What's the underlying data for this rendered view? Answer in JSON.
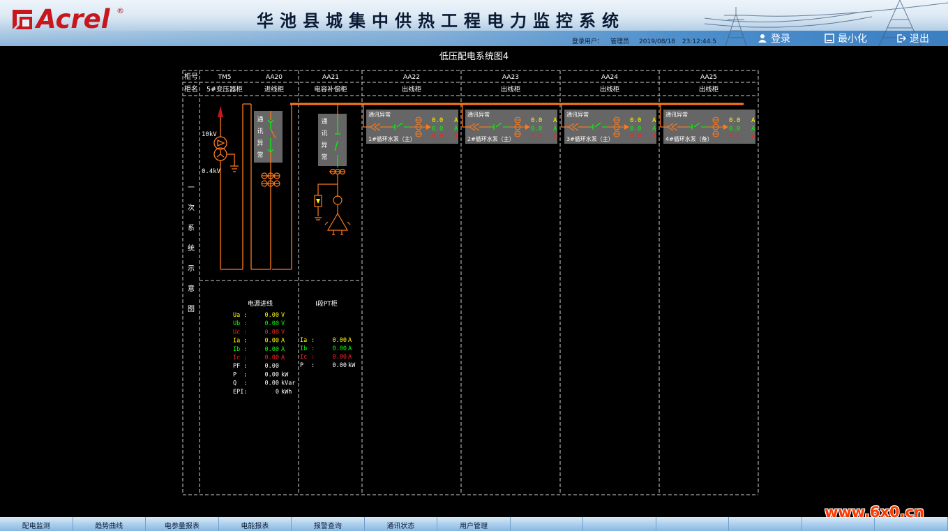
{
  "header": {
    "brand": "Acrel",
    "registered_mark": "®",
    "title": "华池县城集中供热工程电力监控系统",
    "user_label": "登录用户：",
    "user_name": "管理员",
    "date": "2019/08/18",
    "time": "23:12:44.5",
    "login": "登录",
    "minimize": "最小化",
    "exit": "退出"
  },
  "page_title": "低压配电系统图4",
  "table": {
    "row1_label": "柜号",
    "row2_label": "柜名",
    "cabinets": [
      {
        "id": "TM5",
        "name": "5#变压器柜"
      },
      {
        "id": "AA20",
        "name": "进线柜"
      },
      {
        "id": "AA21",
        "name": "电容补偿柜"
      },
      {
        "id": "AA22",
        "name": "出线柜"
      },
      {
        "id": "AA23",
        "name": "出线柜"
      },
      {
        "id": "AA24",
        "name": "出线柜"
      },
      {
        "id": "AA25",
        "name": "出线柜"
      }
    ],
    "side_label": [
      "一",
      "次",
      "系",
      "统",
      "示",
      "意",
      "图"
    ]
  },
  "transformer": {
    "hv": "10kV",
    "lv": "0.4kV"
  },
  "comm_alarm_vertical": [
    "通",
    "讯",
    "异",
    "常"
  ],
  "outgoing": [
    {
      "alarm": "通讯异常",
      "name": "1#循环水泵（主）",
      "v1": "0.0",
      "v2": "0.0",
      "v3": "0.0",
      "unit": "A"
    },
    {
      "alarm": "通讯异常",
      "name": "2#循环水泵（主）",
      "v1": "0.0",
      "v2": "0.0",
      "v3": "0.0",
      "unit": "A"
    },
    {
      "alarm": "通讯异常",
      "name": "3#循环水泵（主）",
      "v1": "0.0",
      "v2": "0.0",
      "v3": "0.0",
      "unit": "A"
    },
    {
      "alarm": "通讯异常",
      "name": "4#循环水泵（备）",
      "v1": "0.0",
      "v2": "0.0",
      "v3": "0.0",
      "unit": "A"
    }
  ],
  "incoming": {
    "title": "电源进线",
    "rows": [
      {
        "label": "Ua",
        "sep": ":",
        "value": "0.00",
        "unit": "V",
        "color": "#ffff00"
      },
      {
        "label": "Ub",
        "sep": ":",
        "value": "0.00",
        "unit": "V",
        "color": "#00ff00"
      },
      {
        "label": "Uc",
        "sep": ":",
        "value": "0.00",
        "unit": "V",
        "color": "#ff2020"
      },
      {
        "label": "Ia",
        "sep": ":",
        "value": "0.00",
        "unit": "A",
        "color": "#ffff00"
      },
      {
        "label": "Ib",
        "sep": ":",
        "value": "0.00",
        "unit": "A",
        "color": "#00ff00"
      },
      {
        "label": "Ic",
        "sep": ":",
        "value": "0.00",
        "unit": "A",
        "color": "#ff2020"
      },
      {
        "label": "PF",
        "sep": ":",
        "value": "0.00",
        "unit": "",
        "color": "#ffffff"
      },
      {
        "label": "P",
        "sep": ":",
        "value": "0.00",
        "unit": "kW",
        "color": "#ffffff"
      },
      {
        "label": "Q",
        "sep": ":",
        "value": "0.00",
        "unit": "kVar",
        "color": "#ffffff"
      },
      {
        "label": "EPI",
        "sep": ":",
        "value": "0",
        "unit": "kWh",
        "color": "#ffffff"
      }
    ]
  },
  "pt": {
    "title": "I段PT柜",
    "rows": [
      {
        "label": "Ia",
        "sep": ":",
        "value": "0.00",
        "unit": "A",
        "color": "#ffff00"
      },
      {
        "label": "Ib",
        "sep": ":",
        "value": "0.00",
        "unit": "A",
        "color": "#00ff00"
      },
      {
        "label": "Ic",
        "sep": ":",
        "value": "0.00",
        "unit": "A",
        "color": "#ff2020"
      },
      {
        "label": "P",
        "sep": ":",
        "value": "0.00",
        "unit": "kW",
        "color": "#ffffff"
      }
    ]
  },
  "nav": [
    "配电监测",
    "趋势曲线",
    "电参量报表",
    "电能报表",
    "报警查询",
    "通讯状态",
    "用户管理",
    "",
    "",
    "",
    "",
    "",
    ""
  ],
  "watermark": "www.6x0.cn",
  "colors": {
    "bus": "#ff7a1a",
    "alarm_panel": "#666666",
    "green": "#00ff00",
    "yellow": "#ffff00",
    "red": "#ff2020",
    "nav_blue": "#9cc6ea"
  }
}
